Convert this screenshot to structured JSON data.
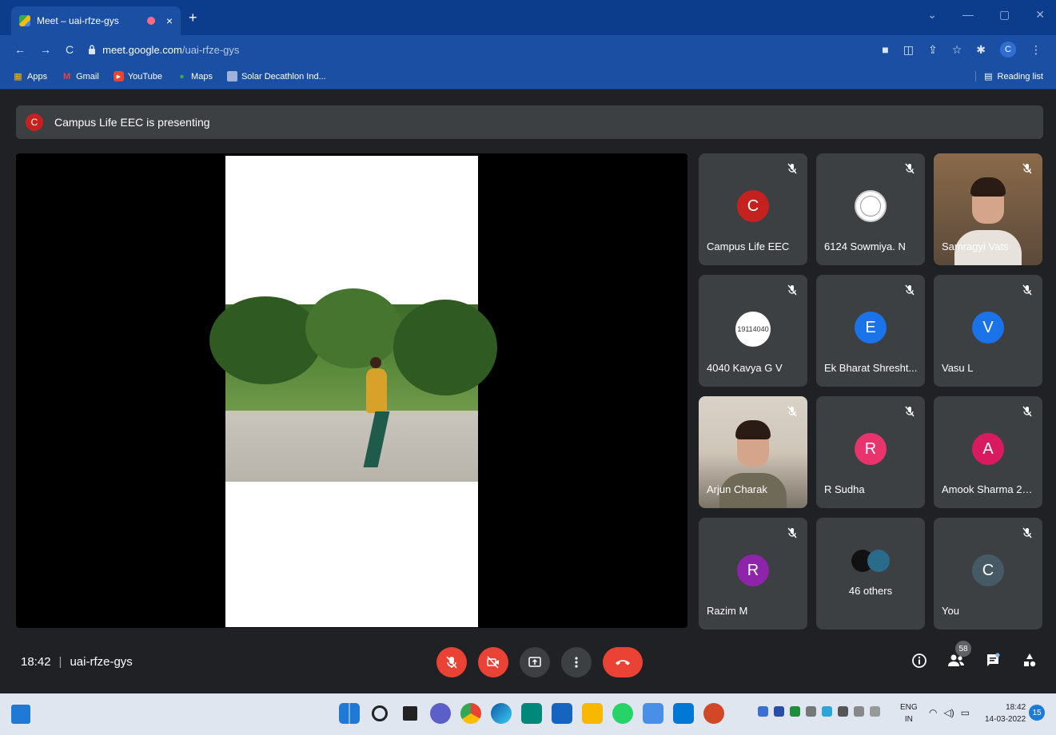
{
  "browser": {
    "tab_title": "Meet – uai-rfze-gys",
    "tab_close": "×",
    "new_tab": "+",
    "url_host": "meet.google.com",
    "url_path": "/uai-rfze-gys",
    "profile_initial": "C",
    "bookmarks": [
      {
        "label": "Apps",
        "icon": "apps-grid-icon"
      },
      {
        "label": "Gmail",
        "icon": "gmail-icon"
      },
      {
        "label": "YouTube",
        "icon": "youtube-icon"
      },
      {
        "label": "Maps",
        "icon": "maps-icon"
      },
      {
        "label": "Solar Decathlon Ind...",
        "icon": "solar-decathlon-icon"
      }
    ],
    "reading_list": "Reading list"
  },
  "meet": {
    "presenter_initial": "C",
    "presenting_text": "Campus Life EEC is presenting",
    "participants": [
      {
        "name": "Campus Life EEC",
        "initial": "C",
        "color": "#c5221f"
      },
      {
        "name": "6124 Sowmiya. N",
        "initial": "",
        "color": "#ffffff"
      },
      {
        "name": "Samragyi Vats",
        "initial": "",
        "color": ""
      },
      {
        "name": "4040 Kavya G V",
        "initial": "19114040",
        "color": "#ffffff"
      },
      {
        "name": "Ek Bharat Shresht...",
        "initial": "E",
        "color": "#1a73e8"
      },
      {
        "name": "Vasu L",
        "initial": "V",
        "color": "#1a73e8"
      },
      {
        "name": "Arjun Charak",
        "initial": "",
        "color": ""
      },
      {
        "name": "R Sudha",
        "initial": "R",
        "color": "#e8336d"
      },
      {
        "name": "Amook Sharma 20i...",
        "initial": "A",
        "color": "#d81b60"
      },
      {
        "name": "Razim M",
        "initial": "R",
        "color": "#8e24aa"
      },
      {
        "name": "",
        "initial": "",
        "color": ""
      },
      {
        "name": "You",
        "initial": "C",
        "color": "#455a64"
      }
    ],
    "others_label": "46 others",
    "time": "18:42",
    "separator": "|",
    "meeting_code": "uai-rfze-gys",
    "participant_count": "58"
  },
  "taskbar": {
    "lang_line1": "ENG",
    "lang_line2": "IN",
    "clock_time": "18:42",
    "clock_date": "14-03-2022",
    "notification_count": "15"
  },
  "colors": {
    "meet_bg": "#202124",
    "tile_bg": "#3c4043",
    "end_call": "#ea4335",
    "browser_blue": "#1a4fa3"
  }
}
